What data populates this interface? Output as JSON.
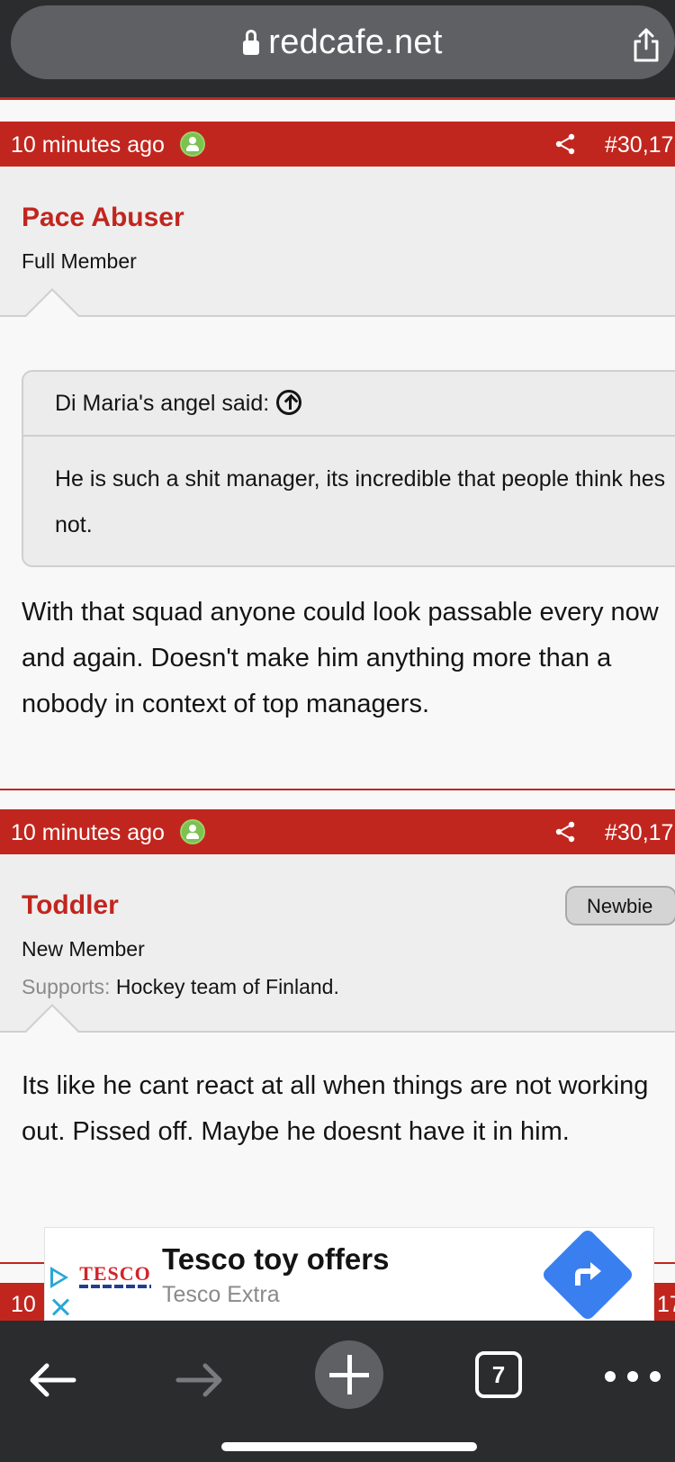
{
  "browser": {
    "url": "redcafe.net",
    "tab_count": "7"
  },
  "posts": [
    {
      "time": "10 minutes ago",
      "number": "#30,17",
      "username": "Pace Abuser",
      "user_title": "Full Member",
      "quote": {
        "author_line": "Di Maria's angel said:",
        "text": "He is such a shit manager, its incredible that people think hes not."
      },
      "message": "With that squad anyone could look passable every now and again. Doesn't make him anything more than a nobody in context of top managers."
    },
    {
      "time": "10 minutes ago",
      "number": "#30,17",
      "username": "Toddler",
      "badge": "Newbie",
      "user_title": "New Member",
      "supports_label": "Supports:",
      "supports_value": "Hockey team of Finland.",
      "message": "Its like he cant react at all when things are not working out. Pissed off. Maybe he doesnt have it in him."
    }
  ],
  "next_post_peek": {
    "left_text": "10",
    "right_text": "17"
  },
  "ad": {
    "logo": "TESCO",
    "title": "Tesco toy offers",
    "subtitle": "Tesco Extra"
  },
  "colors": {
    "brand_red": "#c1261e",
    "online_green": "#7bc24e",
    "toolbar_dark": "#2b2c2e",
    "ad_blue": "#3a7ff0"
  }
}
